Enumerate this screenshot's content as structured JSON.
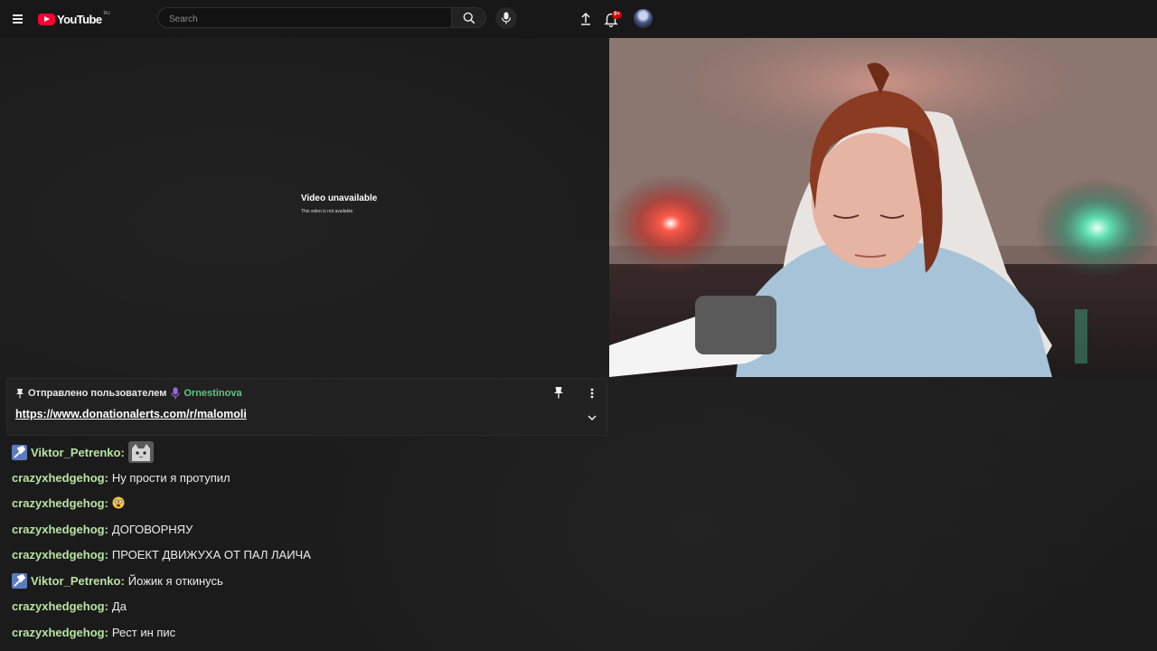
{
  "header": {
    "logo_text": "YouTube",
    "logo_region": "RU",
    "search_placeholder": "Search",
    "notification_count": "9+"
  },
  "player": {
    "error_title": "Video unavailable",
    "error_subtitle": "This video is not available"
  },
  "pinned": {
    "prefix": "Отправлено пользователем",
    "username": "Ornestinova",
    "link": "https://www.donationalerts.com/r/malomoli"
  },
  "chat": {
    "messages": [
      {
        "user": "Viktor_Petrenko:",
        "text": "",
        "badge": "moderator-badge-icon",
        "emote": "cat-emote-icon"
      },
      {
        "user": "crazyxhedgehog:",
        "text": "Ну прости я протупил"
      },
      {
        "user": "crazyxhedgehog:",
        "text": "",
        "emote": "shocked-face-emoji-icon"
      },
      {
        "user": "crazyxhedgehog:",
        "text": "ДОГОВОРНЯУ"
      },
      {
        "user": "crazyxhedgehog:",
        "text": "ПРОЕКТ ДВИЖУХА ОТ ПАЛ ЛАИЧА"
      },
      {
        "user": "Viktor_Petrenko:",
        "text": "Йожик я откинусь",
        "badge": "moderator-badge-icon"
      },
      {
        "user": "crazyxhedgehog:",
        "text": "Да"
      },
      {
        "user": "crazyxhedgehog:",
        "text": "Рест ин пис"
      }
    ]
  },
  "colors": {
    "background": "#1b1b1b",
    "topbar": "#181818",
    "username": "#b8e3a3",
    "pinned_user": "#5fc586",
    "brand_red": "#ff0033"
  }
}
